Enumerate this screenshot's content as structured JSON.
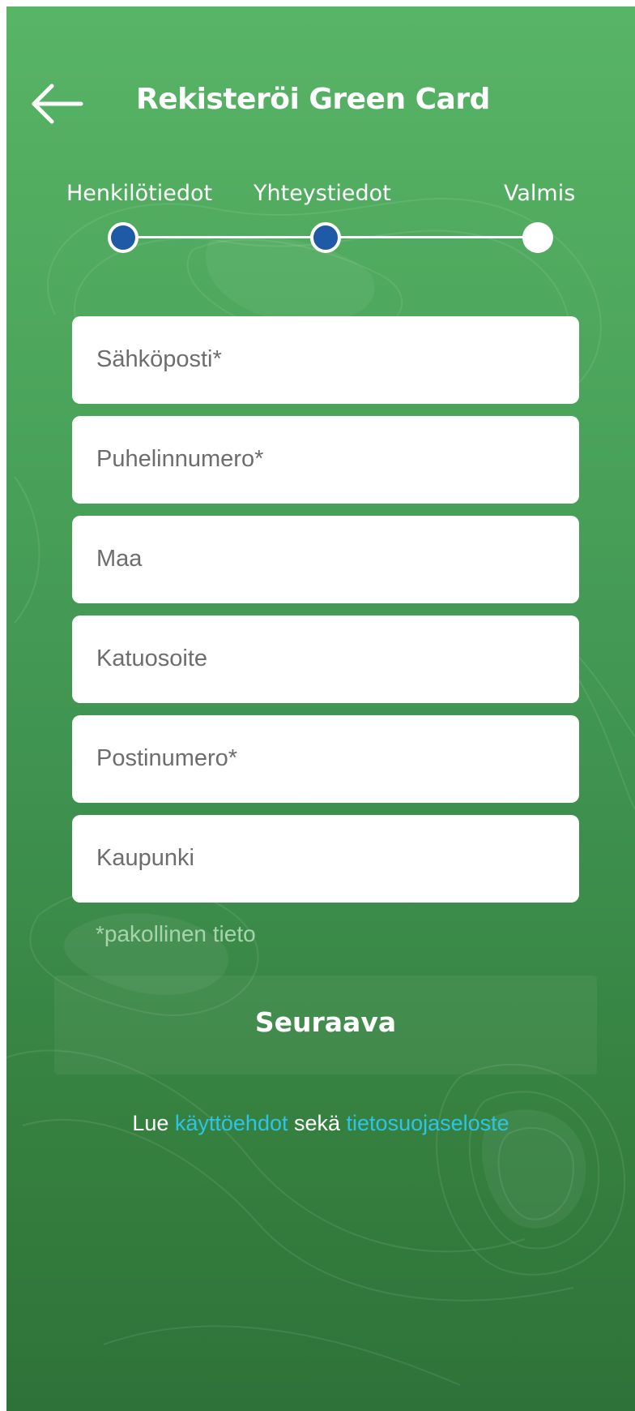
{
  "header": {
    "title": "Rekisteröi Green Card",
    "back_icon": "arrow-left-icon"
  },
  "stepper": {
    "steps": [
      {
        "label": "Henkilötiedot",
        "state": "done"
      },
      {
        "label": "Yhteystiedot",
        "state": "done"
      },
      {
        "label": "Valmis",
        "state": "todo"
      }
    ]
  },
  "form": {
    "fields": [
      {
        "placeholder": "Sähköposti*"
      },
      {
        "placeholder": "Puhelinnumero*"
      },
      {
        "placeholder": "Maa"
      },
      {
        "placeholder": "Katuosoite"
      },
      {
        "placeholder": "Postinumero*"
      },
      {
        "placeholder": "Kaupunki"
      }
    ],
    "required_note": "*pakollinen tieto"
  },
  "actions": {
    "next_label": "Seuraava"
  },
  "terms": {
    "prefix": "Lue ",
    "terms_link": "käyttöehdot",
    "middle": " sekä ",
    "privacy_link": "tietosuojaseloste"
  },
  "colors": {
    "background_top": "#58b466",
    "background_bottom": "#2f7239",
    "step_done": "#1f5aa6",
    "link": "#2ec4e8"
  }
}
